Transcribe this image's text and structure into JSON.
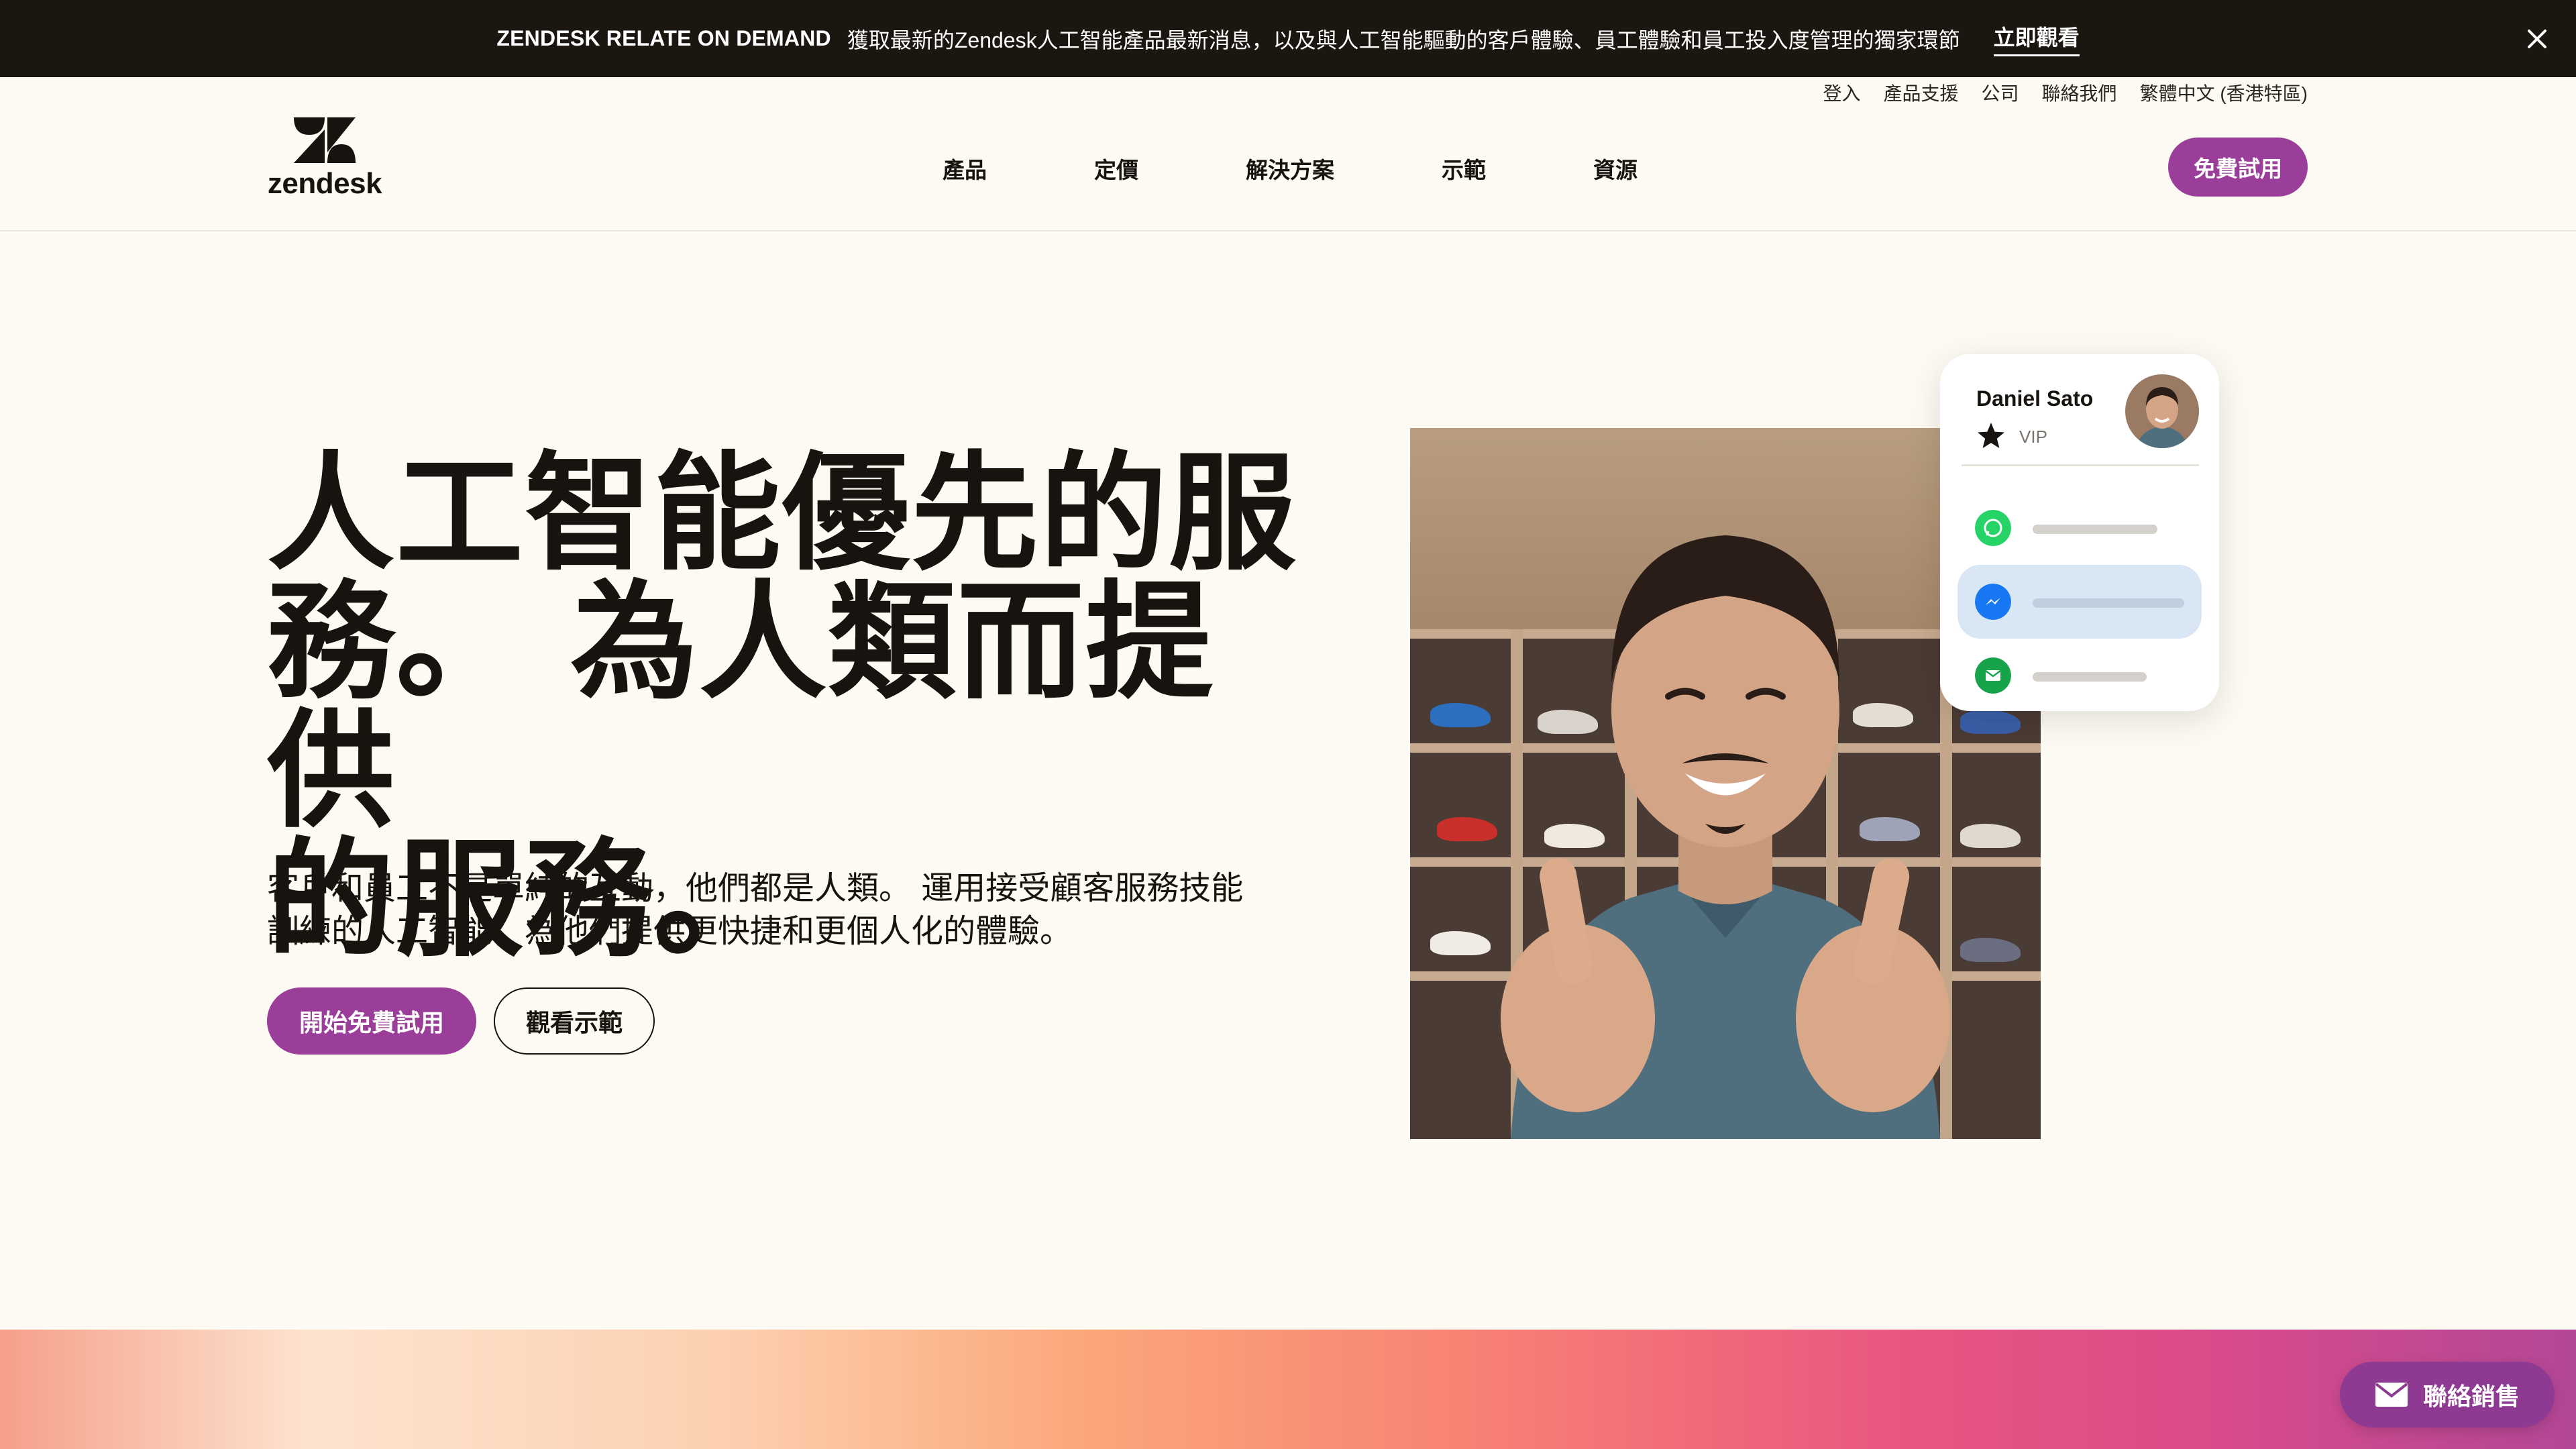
{
  "banner": {
    "title": "ZENDESK RELATE ON DEMAND",
    "text": "獲取最新的Zendesk人工智能產品最新消息，以及與人工智能驅動的客戶體驗、員工體驗和員工投入度管理的獨家環節",
    "cta": "立即觀看",
    "close_icon": "close-icon"
  },
  "utility_nav": {
    "items": [
      "登入",
      "產品支援",
      "公司",
      "聯絡我們",
      "繁體中文 (香港特區)"
    ]
  },
  "header": {
    "logo_text": "zendesk",
    "nav": [
      "產品",
      "定價",
      "解決方案",
      "示範",
      "資源"
    ],
    "trial_button": "免費試用"
  },
  "hero": {
    "title_lines": [
      "人工智能優先的服",
      "務。 為人類而提供",
      "的服務。"
    ],
    "subtitle_lines": [
      "客戶和員工不是單純的互動，他們都是人類。 運用接受顧客服務技能",
      "訓練的人工智能，為他們提供更快捷和更個人化的體驗。"
    ],
    "primary_button": "開始免費試用",
    "secondary_button": "觀看示範"
  },
  "customer_card": {
    "name": "Daniel Sato",
    "tier": "VIP",
    "tier_icon": "star-icon",
    "channels": [
      {
        "icon": "whatsapp-icon",
        "color": "#25d366",
        "active": false
      },
      {
        "icon": "messenger-icon",
        "color": "#1877f2",
        "active": true
      },
      {
        "icon": "email-icon",
        "color": "#16a34a",
        "active": false
      }
    ]
  },
  "floating": {
    "contact_sales": "聯絡銷售",
    "contact_icon": "mail-icon"
  },
  "colors": {
    "banner_bg": "#1b1710",
    "page_bg": "#fdf9f3",
    "accent_purple": "#9a3e9a"
  }
}
